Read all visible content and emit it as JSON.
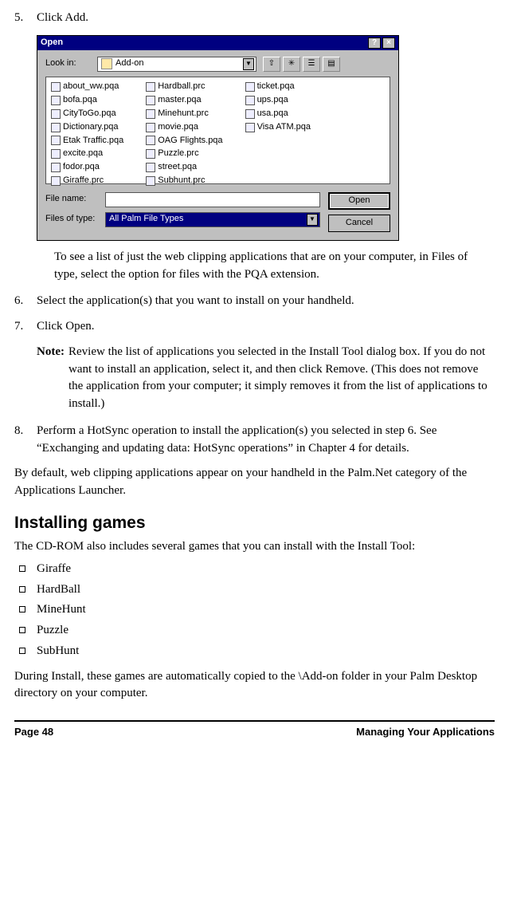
{
  "step5": {
    "num": "5.",
    "text": "Click Add."
  },
  "dialog": {
    "title": "Open",
    "help": "?",
    "close": "×",
    "lookin_label": "Look in:",
    "lookin_value": "Add-on",
    "files_col1": [
      "about_ww.pqa",
      "bofa.pqa",
      "CityToGo.pqa",
      "Dictionary.pqa",
      "Etak Traffic.pqa",
      "excite.pqa",
      "fodor.pqa",
      "Giraffe.prc"
    ],
    "files_col2": [
      "Hardball.prc",
      "master.pqa",
      "Minehunt.prc",
      "movie.pqa",
      "OAG Flights.pqa",
      "Puzzle.prc",
      "street.pqa",
      "Subhunt.prc"
    ],
    "files_col3": [
      "ticket.pqa",
      "ups.pqa",
      "usa.pqa",
      "Visa ATM.pqa"
    ],
    "filename_label": "File name:",
    "filename_value": "",
    "filetype_label": "Files of type:",
    "filetype_value": "All Palm File Types",
    "open_btn": "Open",
    "cancel_btn": "Cancel"
  },
  "tip": "To see a list of just the web clipping applications that are on your computer, in Files of type, select the option for files with the PQA extension.",
  "step6": {
    "num": "6.",
    "text": "Select the application(s) that you want to install on your handheld."
  },
  "step7": {
    "num": "7.",
    "text": "Click Open."
  },
  "note": {
    "label": "Note:",
    "text": "Review the list of applications you selected in the Install Tool dialog box. If you do not want to install an application, select it, and then click Remove. (This does not remove the application from your computer; it simply removes it from the list of applications to install.)"
  },
  "step8": {
    "num": "8.",
    "text": "Perform a HotSync operation to install the application(s) you selected in step 6. See “Exchanging and updating data: HotSync operations” in Chapter 4 for details."
  },
  "para_default": "By default, web clipping applications appear on your handheld in the Palm.Net category of the Applications Launcher.",
  "section_heading": "Installing games",
  "para_games_intro": "The CD-ROM also includes several games that you can install with the Install Tool:",
  "games": [
    "Giraffe",
    "HardBall",
    "MineHunt",
    "Puzzle",
    "SubHunt"
  ],
  "para_games_copy": "During Install, these games are automatically copied to the \\Add-on folder in your Palm Desktop directory on your computer.",
  "footer": {
    "page": "Page 48",
    "chapter": "Managing Your Applications"
  }
}
